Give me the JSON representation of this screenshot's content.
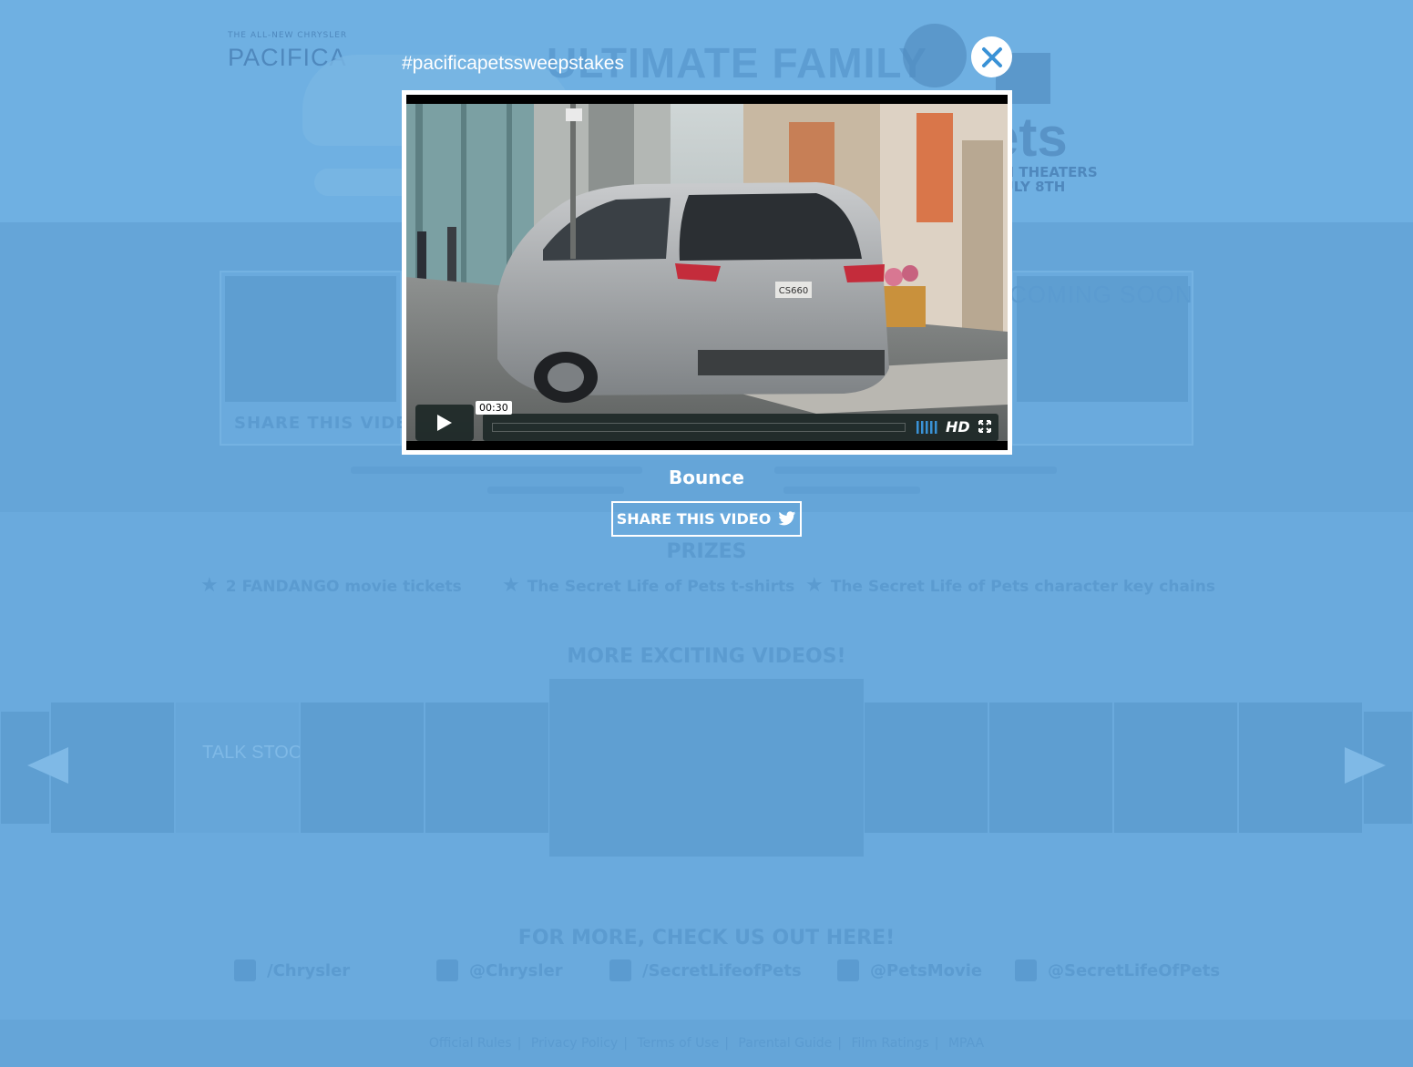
{
  "background": {
    "brand_small": "THE ALL-NEW CHRYSLER",
    "brand_big": "PACIFICA",
    "hero_title": "ULTIMATE FAMILY",
    "pets_logo": {
      "line1": "IN THEATERS",
      "line2": "JULY 8TH"
    },
    "card_label": "SHARE THIS VIDEO",
    "coming_soon": "COMING SOON",
    "prizes_title": "PRIZES",
    "prizes": [
      {
        "text": "2 FANDANGO movie tickets"
      },
      {
        "text": "The Secret Life of Pets t-shirts"
      },
      {
        "text": "The Secret Life of Pets character key chains"
      }
    ],
    "more_title": "MORE EXCITING VIDEOS!",
    "carousel_tile_text": "TALK STOOP",
    "social_title": "FOR MORE, CHECK US OUT HERE!",
    "social": [
      {
        "icon": "facebook-icon",
        "label": "/Chrysler"
      },
      {
        "icon": "twitter-icon",
        "label": "@Chrysler"
      },
      {
        "icon": "facebook-icon",
        "label": "/SecretLifeofPets"
      },
      {
        "icon": "twitter-icon",
        "label": "@PetsMovie"
      },
      {
        "icon": "instagram-icon",
        "label": "@SecretLifeOfPets"
      }
    ],
    "footer_links": [
      "Official Rules",
      "Privacy Policy",
      "Terms of Use",
      "Parental Guide",
      "Film Ratings",
      "MPAA"
    ]
  },
  "modal": {
    "hashtag": "#pacificapetssweepstakes",
    "close_icon": "close-icon",
    "video": {
      "timecode": "00:30",
      "hd_label": "HD",
      "play_icon": "play-icon",
      "volume_icon": "volume-icon",
      "fullscreen_icon": "fullscreen-icon",
      "plate": "CS660"
    },
    "title": "Bounce",
    "share_label": "SHARE THIS VIDEO",
    "share_icon": "twitter-icon"
  },
  "colors": {
    "page_bg": "#6aaadd",
    "accent_blue": "#3a92d6",
    "white": "#ffffff",
    "control_bg": "#172322"
  }
}
